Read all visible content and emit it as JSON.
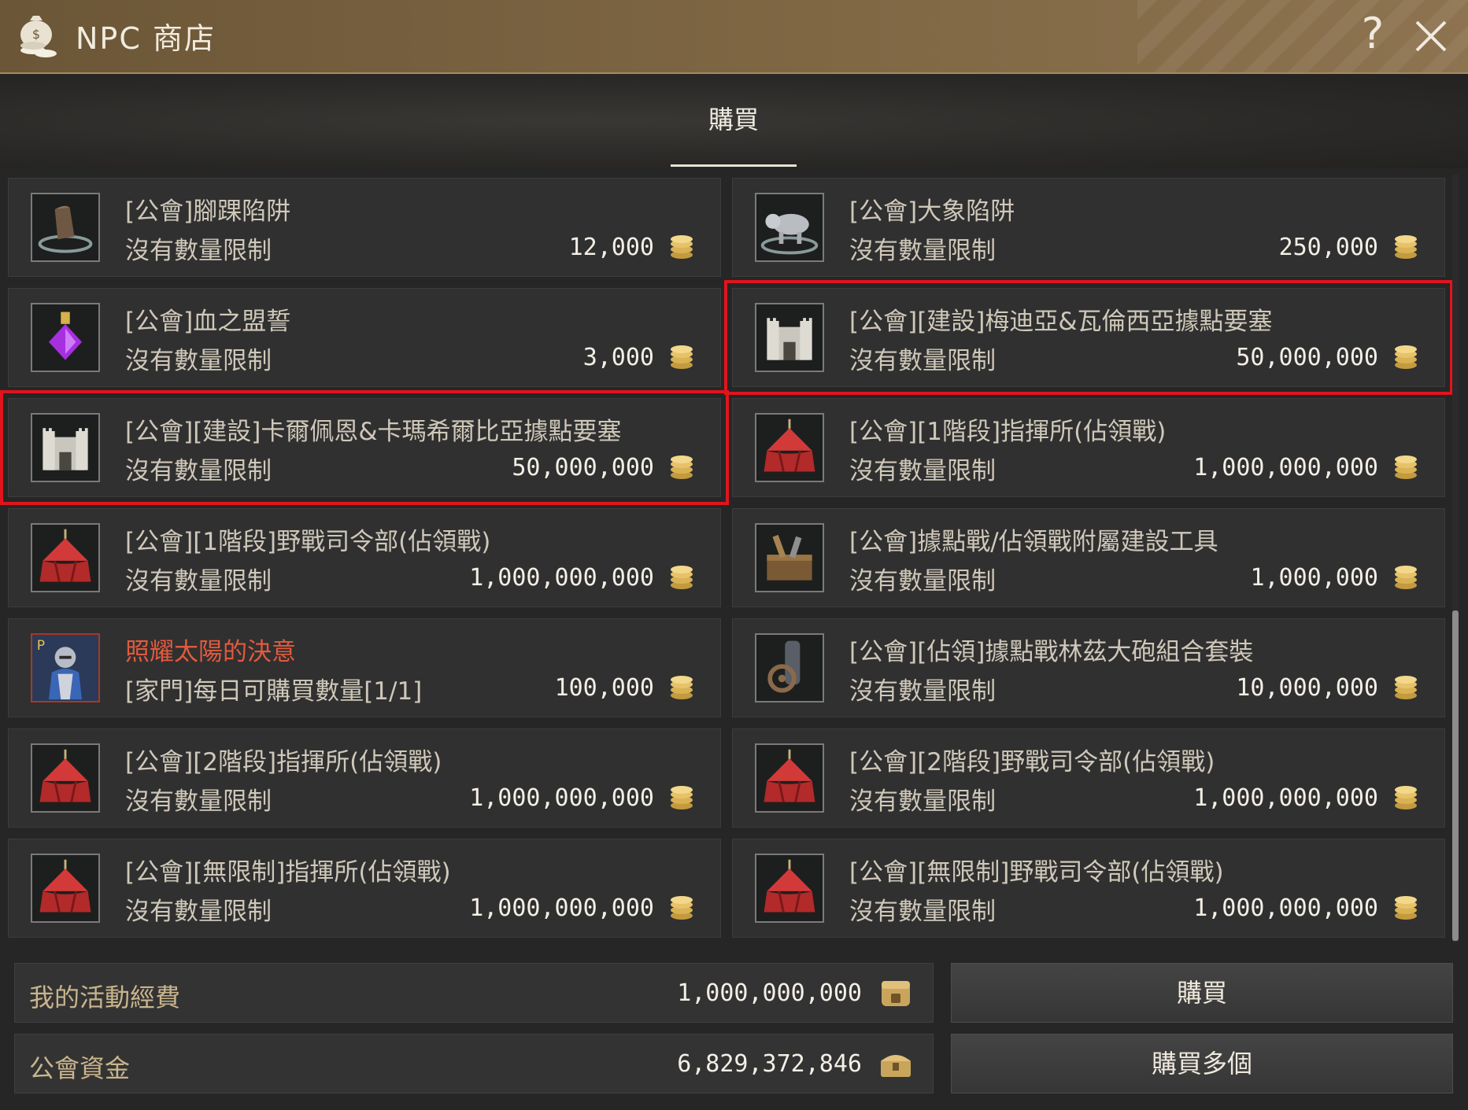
{
  "window": {
    "title": "NPC 商店"
  },
  "tabs": [
    {
      "label": "購買",
      "active": true
    }
  ],
  "items": [
    {
      "name": "[公會]腳踝陷阱",
      "limit": "沒有數量限制",
      "price": "12,000",
      "icon": "ankle-trap-icon"
    },
    {
      "name": "[公會]大象陷阱",
      "limit": "沒有數量限制",
      "price": "250,000",
      "icon": "elephant-trap-icon"
    },
    {
      "name": "[公會]血之盟誓",
      "limit": "沒有數量限制",
      "price": "3,000",
      "icon": "blood-oath-icon"
    },
    {
      "name": "[公會][建設]梅迪亞&瓦倫西亞據點要塞",
      "limit": "沒有數量限制",
      "price": "50,000,000",
      "icon": "fortress-icon",
      "highlighted": true
    },
    {
      "name": "[公會][建設]卡爾佩恩&卡瑪希爾比亞據點要塞",
      "limit": "沒有數量限制",
      "price": "50,000,000",
      "icon": "fortress-icon",
      "highlighted": true
    },
    {
      "name": "[公會][1階段]指揮所(佔領戰)",
      "limit": "沒有數量限制",
      "price": "1,000,000,000",
      "icon": "tent-icon"
    },
    {
      "name": "[公會][1階段]野戰司令部(佔領戰)",
      "limit": "沒有數量限制",
      "price": "1,000,000,000",
      "icon": "tent-icon"
    },
    {
      "name": "[公會]據點戰/佔領戰附屬建設工具",
      "limit": "沒有數量限制",
      "price": "1,000,000",
      "icon": "toolbox-icon"
    },
    {
      "name": "照耀太陽的決意",
      "limit": "[家門]每日可購買數量[1/1]",
      "price": "100,000",
      "icon": "knight-icon",
      "special": true
    },
    {
      "name": "[公會][佔領]據點戰林茲大砲組合套裝",
      "limit": "沒有數量限制",
      "price": "10,000,000",
      "icon": "cannon-icon"
    },
    {
      "name": "[公會][2階段]指揮所(佔領戰)",
      "limit": "沒有數量限制",
      "price": "1,000,000,000",
      "icon": "tent-icon"
    },
    {
      "name": "[公會][2階段]野戰司令部(佔領戰)",
      "limit": "沒有數量限制",
      "price": "1,000,000,000",
      "icon": "tent-icon"
    },
    {
      "name": "[公會][無限制]指揮所(佔領戰)",
      "limit": "沒有數量限制",
      "price": "1,000,000,000",
      "icon": "tent-icon"
    },
    {
      "name": "[公會][無限制]野戰司令部(佔領戰)",
      "limit": "沒有數量限制",
      "price": "1,000,000,000",
      "icon": "tent-icon"
    }
  ],
  "funds": {
    "activity": {
      "label": "我的活動經費",
      "value": "1,000,000,000",
      "icon": "activity-funds-icon"
    },
    "guild": {
      "label": "公會資金",
      "value": "6,829,372,846",
      "icon": "guild-chest-icon"
    }
  },
  "buttons": {
    "buy": "購買",
    "buy_multiple": "購買多個"
  },
  "colors": {
    "highlight": "#e0141c",
    "special_name": "#e25a3e",
    "titlebar": "#7f6744"
  }
}
